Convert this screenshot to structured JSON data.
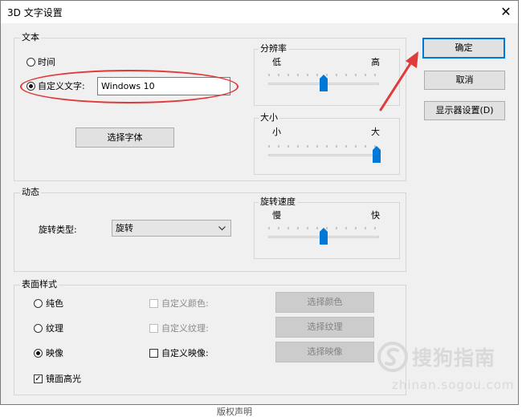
{
  "window": {
    "title": "3D 文字设置",
    "close_glyph": "✕"
  },
  "text_group": {
    "label": "文本",
    "radio_time": "时间",
    "radio_custom": "自定义文字:",
    "custom_value": "Windows 10",
    "choose_font": "选择字体"
  },
  "resolution": {
    "label": "分辨率",
    "low": "低",
    "high": "高",
    "value_fraction": 0.5
  },
  "size": {
    "label": "大小",
    "small": "小",
    "large": "大",
    "value_fraction": 1.0
  },
  "dynamic_group": {
    "label": "动态",
    "rotation_type_label": "旋转类型:",
    "rotation_type_value": "旋转"
  },
  "rotation_speed": {
    "label": "旋转速度",
    "slow": "慢",
    "fast": "快",
    "value_fraction": 0.5
  },
  "surface_group": {
    "label": "表面样式",
    "solid": "纯色",
    "texture": "纹理",
    "reflection": "映像",
    "custom_color": "自定义颜色:",
    "custom_texture": "自定义纹理:",
    "custom_reflection": "自定义映像:",
    "choose_color": "选择颜色",
    "choose_texture": "选择纹理",
    "choose_reflection": "选择映像",
    "specular": "镜面高光"
  },
  "buttons": {
    "ok": "确定",
    "cancel": "取消",
    "display_settings": "显示器设置(D)"
  },
  "watermark": {
    "brand": "搜狗指南",
    "url": "zhinan.sogou.com"
  },
  "below_window_text": "版权声明",
  "colors": {
    "accent": "#0078d7",
    "annotation_red": "#e03a3a"
  }
}
